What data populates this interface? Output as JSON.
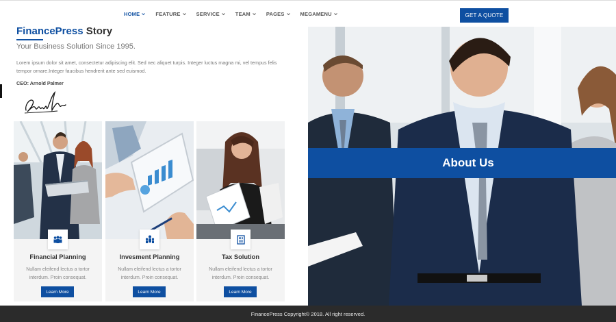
{
  "nav": {
    "items": [
      {
        "label": "HOME",
        "active": true
      },
      {
        "label": "FEATURE",
        "active": false
      },
      {
        "label": "SERVICE",
        "active": false
      },
      {
        "label": "TEAM",
        "active": false
      },
      {
        "label": "PAGES",
        "active": false
      },
      {
        "label": "MEGAMENU",
        "active": false
      }
    ],
    "cta_label": "GET A QUOTE"
  },
  "story": {
    "brand": "FinancePress",
    "title_rest": " Story",
    "subtitle": "Your Business Solution Since 1995.",
    "body": "Lorem ipsum dolor sit amet, consectetur adipiscing elit. Sed nec aliquet turpis. Integer luctus magna mi, vel tempus felis tempor ornare.Integer faucibus hendrerit ante sed euismod.",
    "ceo": "CEO: Arnold Palmer"
  },
  "services": [
    {
      "title": "Financial Planning",
      "text": "Nullam eleifend lectus a tortor interdum. Proin consequat.",
      "button": "Learn More",
      "icon": "team-icon"
    },
    {
      "title": "Invesment Planning",
      "text": "Nullam eleifend lectus a tortor interdum. Proin consequat.",
      "button": "Learn More",
      "icon": "network-icon"
    },
    {
      "title": "Tax Solution",
      "text": "Nullam eleifend lectus a tortor interdum. Proin consequat.",
      "button": "Learn More",
      "icon": "tax-document-icon"
    }
  ],
  "hero": {
    "title": "About Us"
  },
  "footer": {
    "text": "FinancePress Copyright© 2018. All right reserved."
  },
  "colors": {
    "accent": "#0e4fa1",
    "footer_bg": "#2b2b2b",
    "card_bg": "#f4f4f4"
  }
}
